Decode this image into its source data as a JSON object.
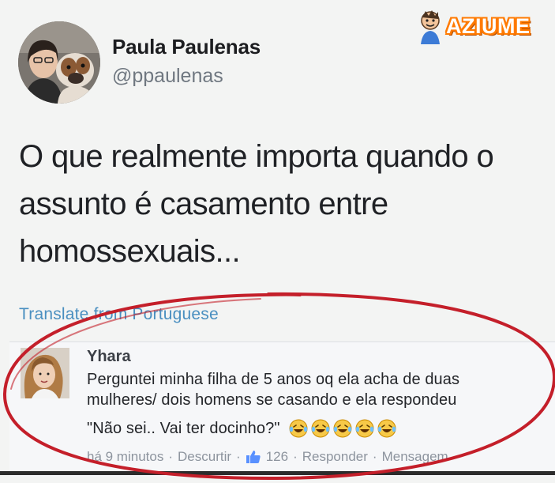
{
  "tweet": {
    "author_name": "Paula Paulenas",
    "author_handle": "@ppaulenas",
    "text": "O que realmente importa quando o assunto é casamento entre homossexuais...",
    "translate_label": "Translate from Portuguese"
  },
  "watermark": {
    "text": "AZIUME"
  },
  "comment": {
    "author": "Yhara",
    "text_line1": "Perguntei minha filha de 5 anos oq ela acha de duas",
    "text_line2": "mulheres/ dois homens se casando e ela respondeu",
    "text_line3": "\"Não sei.. Vai ter docinho?\"",
    "emoji": [
      "laughing-tears-icon",
      "laughing-tears-icon",
      "laughing-tears-icon",
      "laughing-tears-icon",
      "laughing-tears-icon"
    ],
    "meta": {
      "time": "há 9 minutos",
      "unlike": "Descurtir",
      "like_count": "126",
      "reply": "Responder",
      "message": "Mensagem",
      "separator": "·"
    }
  },
  "colors": {
    "link": "#4a8fc0",
    "annotation": "#c41f2a",
    "watermark": "#ff7a00"
  }
}
